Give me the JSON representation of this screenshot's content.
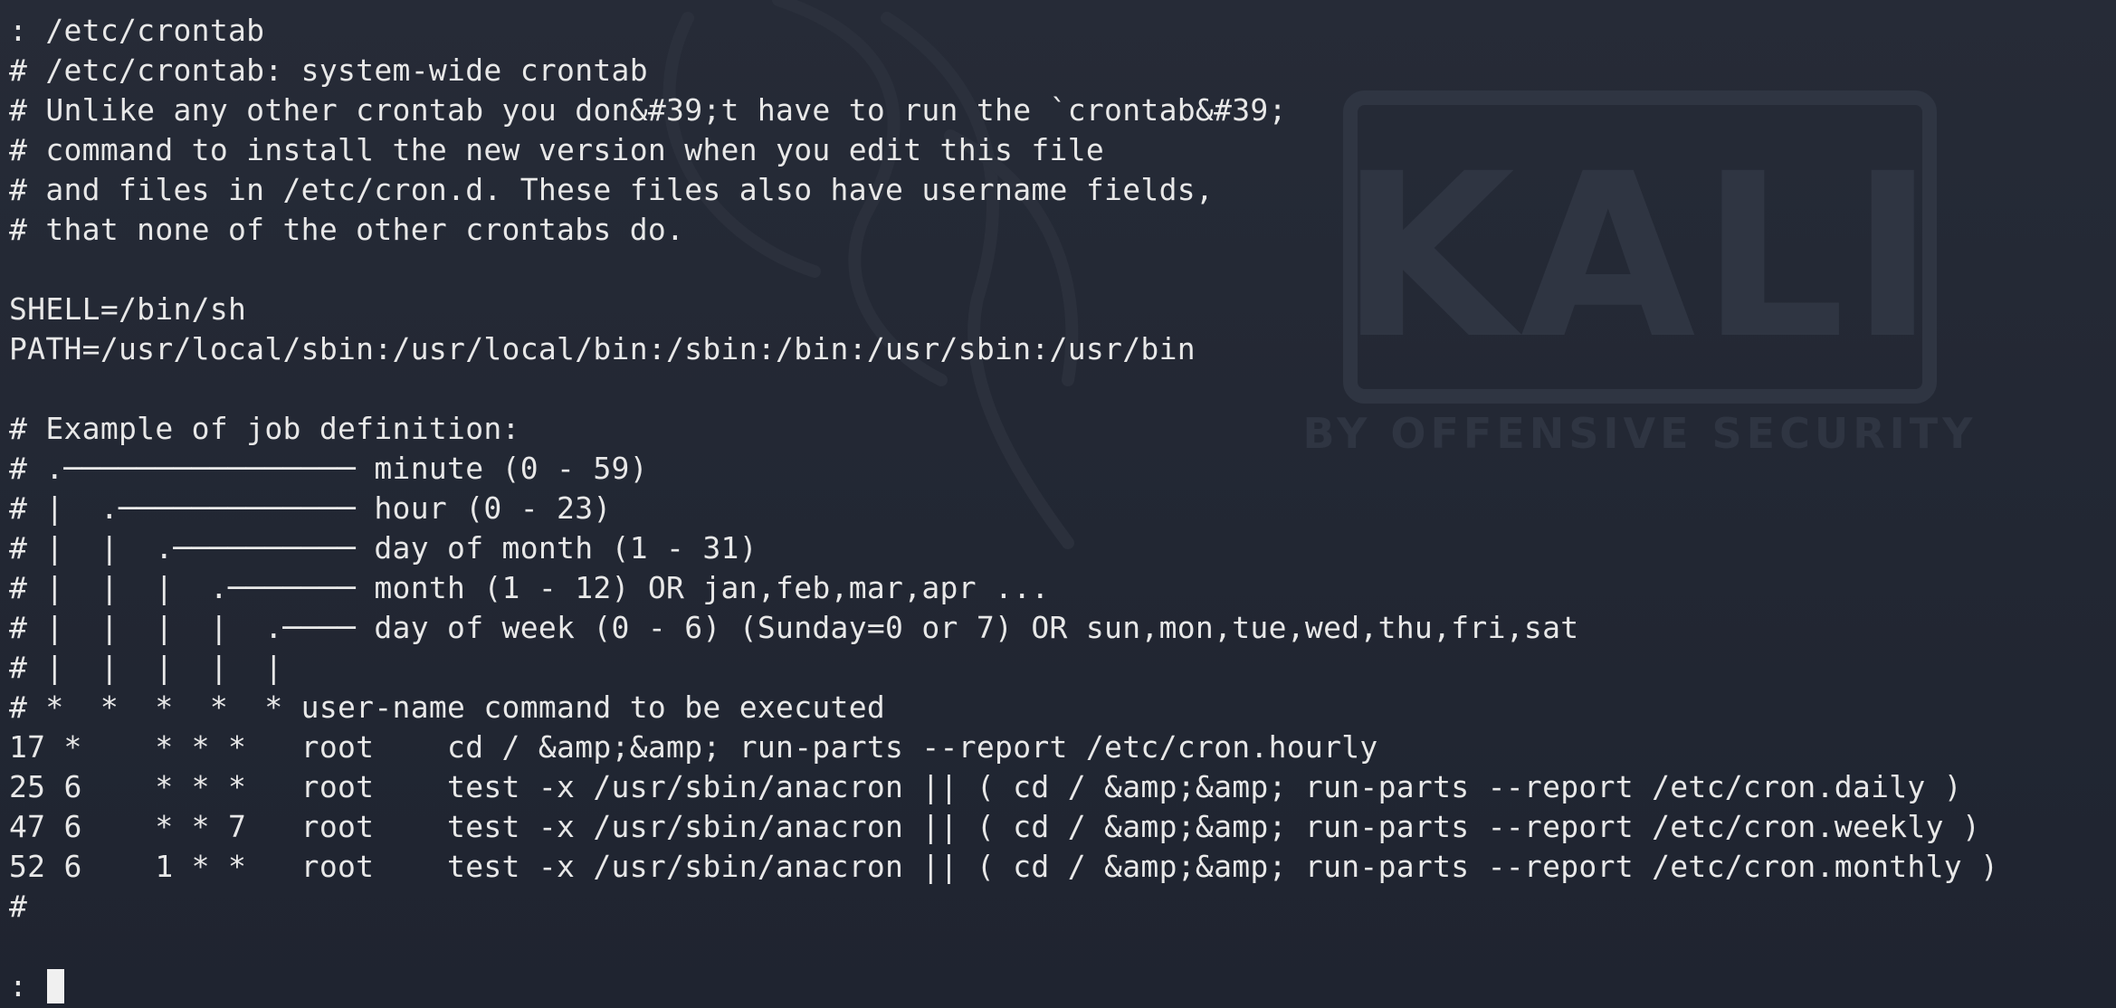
{
  "terminal": {
    "lines": [
      ": /etc/crontab",
      "# /etc/crontab: system-wide crontab",
      "# Unlike any other crontab you don&#39;t have to run the `crontab&#39;",
      "# command to install the new version when you edit this file",
      "# and files in /etc/cron.d. These files also have username fields,",
      "# that none of the other crontabs do.",
      "",
      "SHELL=/bin/sh",
      "PATH=/usr/local/sbin:/usr/local/bin:/sbin:/bin:/usr/sbin:/usr/bin",
      "",
      "# Example of job definition:",
      "# .──────────────── minute (0 - 59)",
      "# |  .───────────── hour (0 - 23)",
      "# |  |  .────────── day of month (1 - 31)",
      "# |  |  |  .─────── month (1 - 12) OR jan,feb,mar,apr ...",
      "# |  |  |  |  .──── day of week (0 - 6) (Sunday=0 or 7) OR sun,mon,tue,wed,thu,fri,sat",
      "# |  |  |  |  |",
      "# *  *  *  *  * user-name command to be executed",
      "17 *    * * *   root    cd / &amp;&amp; run-parts --report /etc/cron.hourly",
      "25 6    * * *   root    test -x /usr/sbin/anacron || ( cd / &amp;&amp; run-parts --report /etc/cron.daily )",
      "47 6    * * 7   root    test -x /usr/sbin/anacron || ( cd / &amp;&amp; run-parts --report /etc/cron.weekly )",
      "52 6    1 * *   root    test -x /usr/sbin/anacron || ( cd / &amp;&amp; run-parts --report /etc/cron.monthly )",
      "#",
      ""
    ],
    "prompt": ": "
  },
  "wallpaper": {
    "brand": "KALI",
    "tagline": "BY OFFENSIVE SECURITY"
  },
  "colors": {
    "background": "#232834",
    "text": "#e8e8e8",
    "watermark": "#2d3340"
  }
}
